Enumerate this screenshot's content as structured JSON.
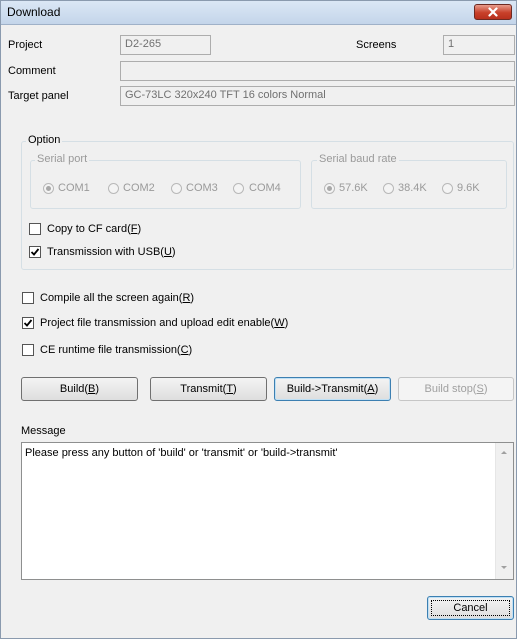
{
  "window": {
    "title": "Download",
    "close_icon": "close-icon"
  },
  "project": {
    "label": "Project",
    "value": "D2-265"
  },
  "screens": {
    "label": "Screens",
    "value": "1"
  },
  "comment": {
    "label": "Comment",
    "value": ""
  },
  "target_panel": {
    "label": "Target panel",
    "value": "GC-73LC 320x240 TFT 16 colors Normal"
  },
  "option": {
    "title": "Option",
    "serial_port": {
      "title": "Serial port",
      "options": [
        "COM1",
        "COM2",
        "COM3",
        "COM4"
      ],
      "selected": "COM1"
    },
    "baud_rate": {
      "title": "Serial baud rate",
      "options": [
        "57.6K",
        "38.4K",
        "9.6K"
      ],
      "selected": "57.6K"
    },
    "copy_cf": {
      "label": "Copy to CF card(",
      "mnemonic": "F",
      "suffix": ")",
      "checked": false
    },
    "usb": {
      "label": "Transmission with USB(",
      "mnemonic": "U",
      "suffix": ")",
      "checked": true
    }
  },
  "checks": {
    "compile": {
      "label": "Compile all the screen again(",
      "mnemonic": "R",
      "suffix": ")",
      "checked": false
    },
    "project_file": {
      "label": "Project file transmission and upload edit enable(",
      "mnemonic": "W",
      "suffix": ")",
      "checked": true
    },
    "ce_runtime": {
      "label": "CE runtime file transmission(",
      "mnemonic": "C",
      "suffix": ")",
      "checked": false
    }
  },
  "buttons": {
    "build": {
      "label": "Build(",
      "mnemonic": "B",
      "suffix": ")"
    },
    "transmit": {
      "label": "Transmit(",
      "mnemonic": "T",
      "suffix": ")"
    },
    "build_transmit": {
      "label": "Build->Transmit(",
      "mnemonic": "A",
      "suffix": ")"
    },
    "build_stop": {
      "label": "Build stop(",
      "mnemonic": "S",
      "suffix": ")"
    },
    "cancel": {
      "label": "Cancel"
    }
  },
  "message": {
    "label": "Message",
    "text": "Please press any button of 'build' or 'transmit' or 'build->transmit'"
  },
  "colors": {
    "title_bar": "#c4d5ea",
    "close_button": "#c8402a",
    "dialog_bg": "#f0f0f0"
  }
}
